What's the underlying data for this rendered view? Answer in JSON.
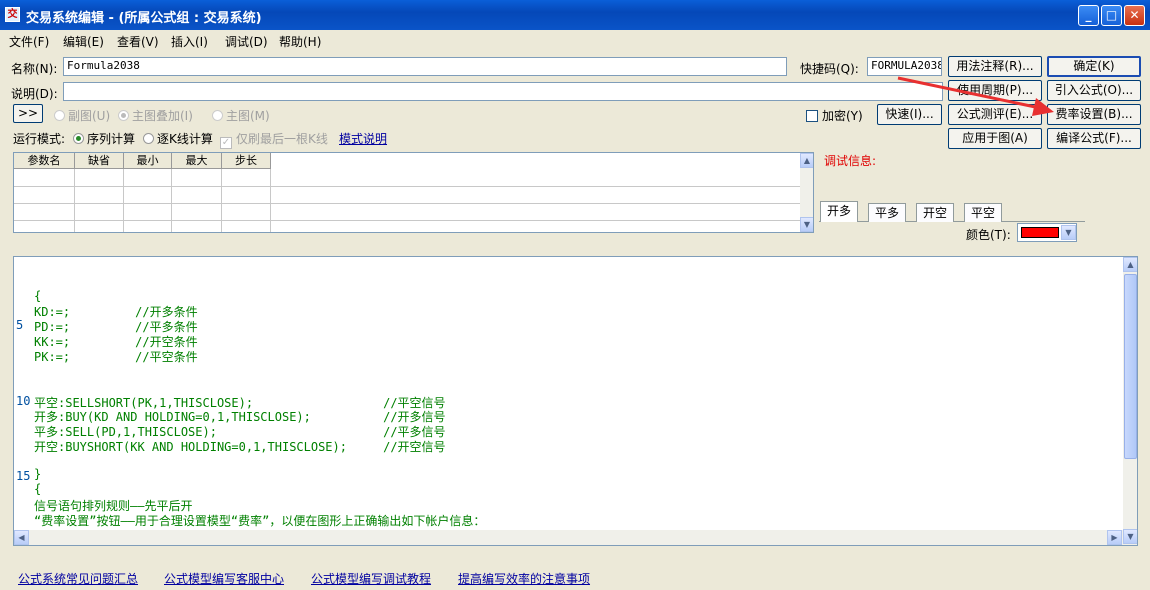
{
  "window": {
    "title": "交易系统编辑 - (所属公式组 : 交易系统)"
  },
  "menu": [
    "文件(F)",
    "编辑(E)",
    "查看(V)",
    "插入(I)",
    "调试(D)",
    "帮助(H)"
  ],
  "form": {
    "name_label": "名称(N):",
    "name_value": "Formula2038",
    "shortcut_label": "快捷码(Q):",
    "shortcut_value": "FORMULA2038",
    "desc_label": "说明(D):",
    "desc_value": ""
  },
  "buttons": {
    "usage": "用法注释(R)...",
    "ok": "确定(K)",
    "period": "使用周期(P)...",
    "import": "引入公式(O)...",
    "test": "公式测评(E)...",
    "fee": "费率设置(B)...",
    "apply": "应用于图(A)",
    "compile": "编译公式(F)...",
    "quick": "快速(I)...",
    "expand": ">>"
  },
  "options": {
    "sub_chart": "副图(U)",
    "main_overlay": "主图叠加(I)",
    "main_chart": "主图(M)",
    "encrypt": "加密(Y)"
  },
  "run_mode": {
    "label": "运行模式:",
    "seq": "序列计算",
    "bar": "逐K线计算",
    "refresh_last": "仅刷最后一根K线",
    "mode_link": "模式说明"
  },
  "params": {
    "headers": [
      "参数名",
      "缺省",
      "最小",
      "最大",
      "步长"
    ]
  },
  "debug": {
    "label": "调试信息:",
    "tabs": [
      "开多",
      "平多",
      "开空",
      "平空"
    ],
    "color_label": "颜色(T):",
    "color": "#ff0000"
  },
  "code": {
    "lines": [
      {
        "n": "",
        "t": "{"
      },
      {
        "n": "",
        "t": "KD:=;         //开多条件"
      },
      {
        "n": "5",
        "t": "PD:=;         //平多条件"
      },
      {
        "n": "",
        "t": "KK:=;         //开空条件"
      },
      {
        "n": "",
        "t": "PK:=;         //平空条件"
      },
      {
        "n": "10",
        "t": "平空:SELLSHORT(PK,1,THISCLOSE);                  //平空信号"
      },
      {
        "n": "",
        "t": "开多:BUY(KD AND HOLDING=0,1,THISCLOSE);          //开多信号"
      },
      {
        "n": "",
        "t": "平多:SELL(PD,1,THISCLOSE);                       //平多信号"
      },
      {
        "n": "",
        "t": "开空:BUYSHORT(KK AND HOLDING=0,1,THISCLOSE);     //开空信号"
      },
      {
        "n": "15",
        "t": "}"
      },
      {
        "n": "",
        "t": "{"
      },
      {
        "n": "",
        "t": "信号语句排列规则——先平后开"
      },
      {
        "n": "",
        "t": "“费率设置”按钮——用于合理设置模型“费率”，以便在图形上正确输出如下帐户信息："
      }
    ]
  },
  "footer": {
    "links": [
      "公式系统常见问题汇总",
      "公式模型编写客服中心",
      "公式模型编写调试教程",
      "提高编写效率的注意事项"
    ]
  }
}
